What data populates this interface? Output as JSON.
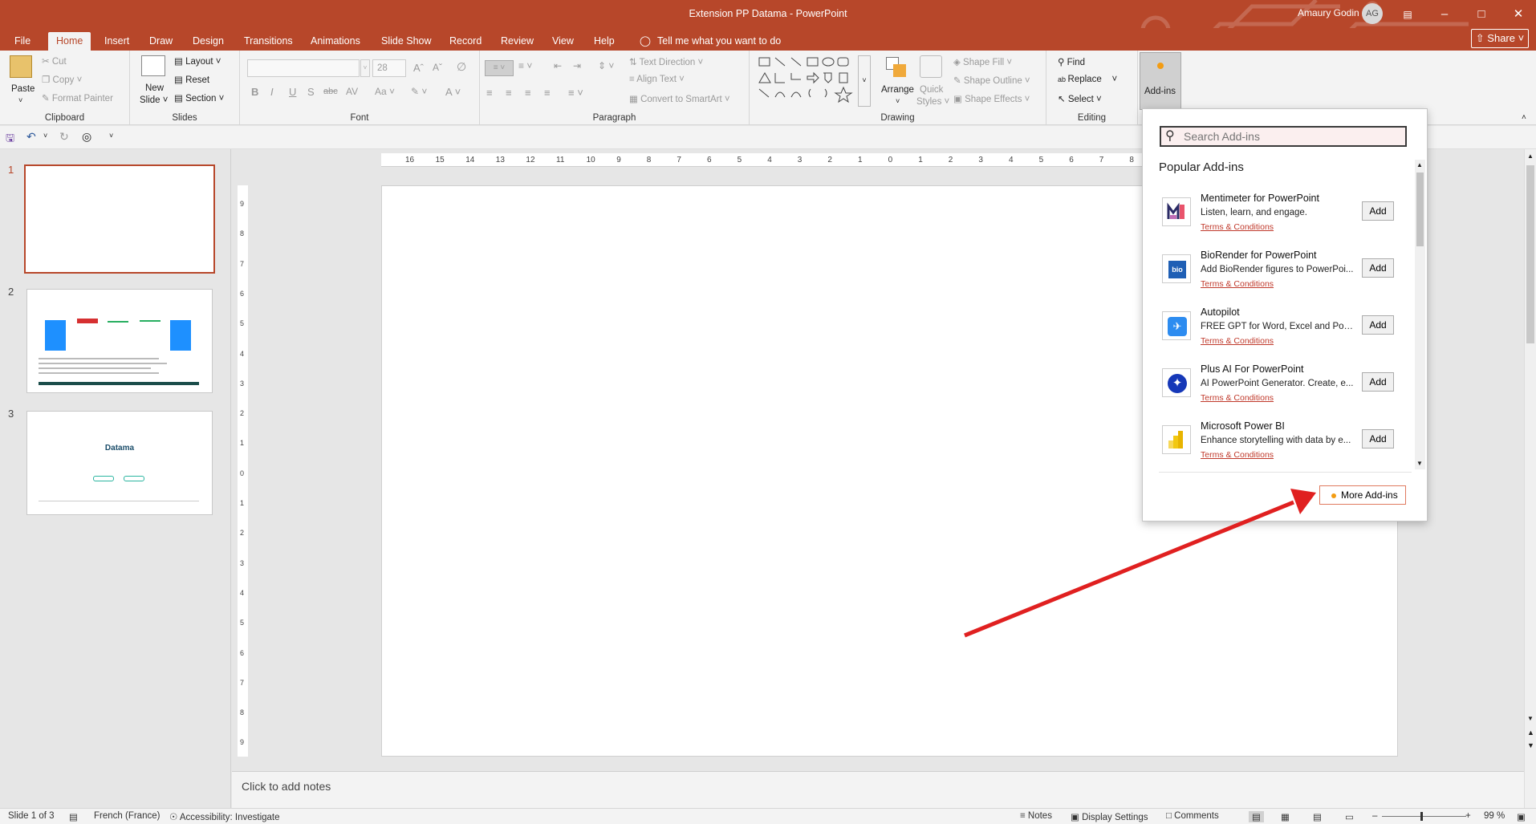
{
  "window": {
    "title": "Extension PP Datama  -  PowerPoint",
    "user_name": "Amaury Godin",
    "user_initials": "AG",
    "share_label": "Share"
  },
  "tabs": [
    "File",
    "Home",
    "Insert",
    "Draw",
    "Design",
    "Transitions",
    "Animations",
    "Slide Show",
    "Record",
    "Review",
    "View",
    "Help"
  ],
  "tell_me": "Tell me what you want to do",
  "ribbon": {
    "clipboard": {
      "paste": "Paste",
      "cut": "Cut",
      "copy": "Copy",
      "format_painter": "Format Painter",
      "label": "Clipboard"
    },
    "slides": {
      "new_slide": "New",
      "new_slide2": "Slide",
      "layout": "Layout",
      "reset": "Reset",
      "section": "Section",
      "label": "Slides"
    },
    "font": {
      "font_size": "28",
      "label": "Font"
    },
    "paragraph": {
      "text_direction": "Text Direction",
      "align_text": "Align Text",
      "convert_smartart": "Convert to SmartArt",
      "label": "Paragraph"
    },
    "drawing": {
      "arrange": "Arrange",
      "quick": "Quick",
      "styles": "Styles",
      "shape_fill": "Shape Fill",
      "shape_outline": "Shape Outline",
      "shape_effects": "Shape Effects",
      "label": "Drawing"
    },
    "editing": {
      "find": "Find",
      "replace": "Replace",
      "select": "Select",
      "label": "Editing"
    },
    "addins": {
      "label": "Add-ins"
    }
  },
  "thumbnails": [
    {
      "number": "1"
    },
    {
      "number": "2"
    },
    {
      "number": "3",
      "slide_title_small": "Datama"
    }
  ],
  "ruler": {
    "h_ticks": [
      "16",
      "15",
      "14",
      "13",
      "12",
      "11",
      "10",
      "9",
      "8",
      "7",
      "6",
      "5",
      "4",
      "3",
      "2",
      "1",
      "0",
      "1",
      "2",
      "3",
      "4",
      "5",
      "6",
      "7",
      "8"
    ],
    "v_ticks": [
      "9",
      "8",
      "7",
      "6",
      "5",
      "4",
      "3",
      "2",
      "1",
      "0",
      "1",
      "2",
      "3",
      "4",
      "5",
      "6",
      "7",
      "8",
      "9"
    ]
  },
  "notes_placeholder": "Click to add notes",
  "addins_panel": {
    "search_placeholder": "Search Add-ins",
    "heading": "Popular Add-ins",
    "items": [
      {
        "name": "Mentimeter for PowerPoint",
        "desc": "Listen, learn, and engage.",
        "terms": "Terms & Conditions",
        "add": "Add",
        "icon": "mentimeter-logo"
      },
      {
        "name": "BioRender for PowerPoint",
        "desc": "Add BioRender figures to PowerPoi...",
        "terms": "Terms & Conditions",
        "add": "Add",
        "icon": "biorender-logo",
        "logo_text": "bio"
      },
      {
        "name": "Autopilot",
        "desc": "FREE GPT for Word, Excel and Powe...",
        "terms": "Terms & Conditions",
        "add": "Add",
        "icon": "autopilot-logo"
      },
      {
        "name": "Plus AI For PowerPoint",
        "desc": "AI PowerPoint Generator. Create, e...",
        "terms": "Terms & Conditions",
        "add": "Add",
        "icon": "plus-ai-logo"
      },
      {
        "name": "Microsoft Power BI",
        "desc": "Enhance storytelling with data by e...",
        "terms": "Terms & Conditions",
        "add": "Add",
        "icon": "power-bi-logo"
      }
    ],
    "more_label": "More Add-ins"
  },
  "status": {
    "slide_count": "Slide 1 of 3",
    "language": "French (France)",
    "accessibility": "Accessibility: Investigate",
    "notes": "Notes",
    "display_settings": "Display Settings",
    "comments": "Comments",
    "zoom": "99 %"
  },
  "colors": {
    "accent": "#b7472a",
    "arrow": "#e02020"
  }
}
